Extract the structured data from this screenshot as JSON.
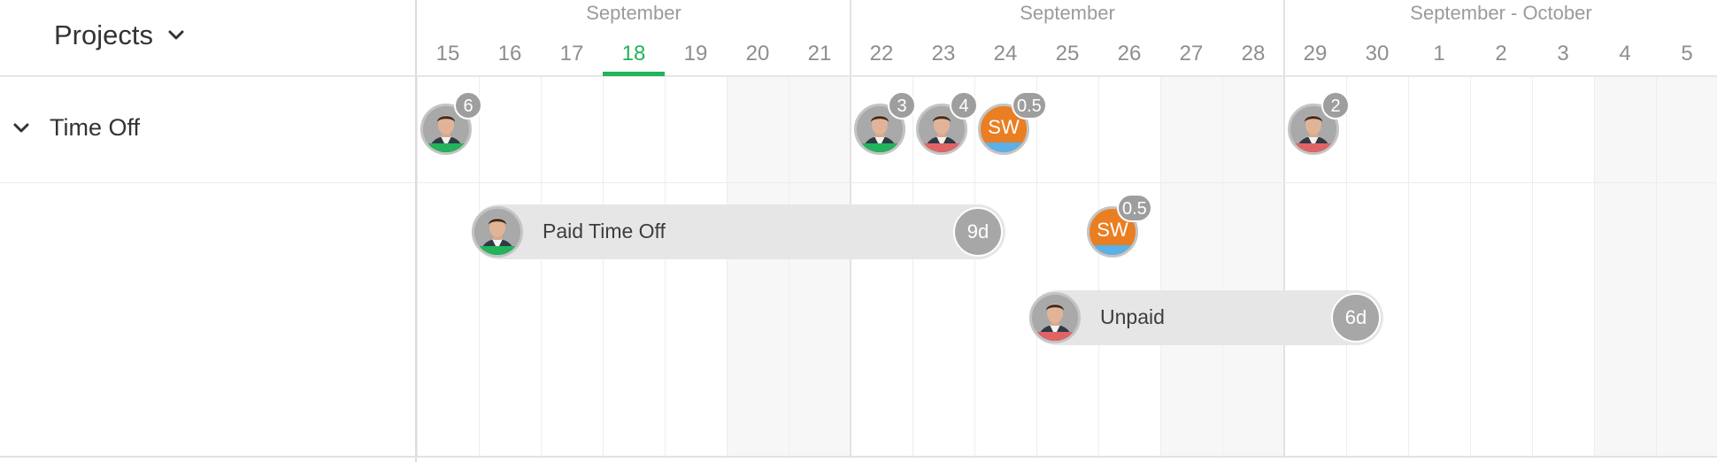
{
  "header": {
    "projects_label": "Projects"
  },
  "group": {
    "label": "Time Off"
  },
  "timeline": {
    "weeks": [
      {
        "month": "September",
        "days": [
          "15",
          "16",
          "17",
          "18",
          "19",
          "20",
          "21"
        ]
      },
      {
        "month": "September",
        "days": [
          "22",
          "23",
          "24",
          "25",
          "26",
          "27",
          "28"
        ]
      },
      {
        "month": "September - October",
        "days": [
          "29",
          "30",
          "1",
          "2",
          "3",
          "4",
          "5"
        ]
      }
    ],
    "today": "18"
  },
  "summary_row": {
    "avatars": [
      {
        "kind": "photo",
        "status": "green",
        "count": "6"
      },
      {
        "kind": "photo",
        "status": "green",
        "count": "3"
      },
      {
        "kind": "photo",
        "status": "red",
        "count": "4"
      },
      {
        "kind": "initials",
        "initials": "SW",
        "status": "blue",
        "count": "0.5"
      },
      {
        "kind": "photo",
        "status": "red",
        "count": "2"
      }
    ]
  },
  "bars": [
    {
      "label": "Paid Time Off",
      "duration": "9d",
      "status": "green"
    },
    {
      "label": "Unpaid",
      "duration": "6d",
      "status": "red"
    }
  ],
  "sw_item": {
    "initials": "SW",
    "count": "0.5",
    "status": "blue"
  },
  "colors": {
    "green": "#23b35a",
    "red": "#e16464",
    "blue": "#5ab0e8",
    "orange": "#ea7e22",
    "today": "#23b35a"
  },
  "icons": {
    "projects_chevron": "chevron-down-icon",
    "group_toggle": "chevron-down-icon"
  }
}
